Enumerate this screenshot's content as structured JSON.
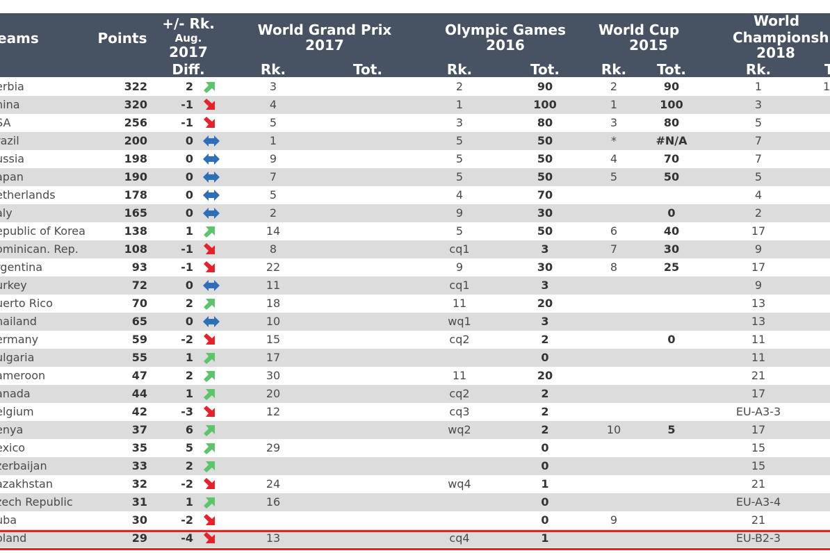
{
  "header": {
    "teams": "eams",
    "points": "Points",
    "rk_change": "+/- Rk.",
    "aug": "Aug.",
    "year_2017": "2017",
    "diff": "Diff.",
    "wgp_line1": "World Grand Prix",
    "wgp_line2": "2017",
    "og_line1": "Olympic Games",
    "og_line2": "2016",
    "wc_line1": "World Cup",
    "wc_line2": "2015",
    "wch_line1": "World",
    "wch_line2": "Championship",
    "wch_line3": "2018",
    "rk": "Rk.",
    "tot": "Tot.",
    "t_cut": "T"
  },
  "colors": {
    "header_bg": "#475362",
    "alt_row": "#dcdcdc",
    "up": "#5cc46b",
    "down": "#e8202a",
    "same": "#2e6fb7",
    "highlight": "#e8202a"
  },
  "rows": [
    {
      "team": "erbia",
      "points": "322",
      "diff": "2",
      "trend": "up",
      "wgp_rk": "3",
      "og_rk": "2",
      "og_tot": "90",
      "wc_rk": "2",
      "wc_tot": "90",
      "wch_rk": "1",
      "wch_tot": "1"
    },
    {
      "team": "hina",
      "points": "320",
      "diff": "-1",
      "trend": "down",
      "wgp_rk": "4",
      "og_rk": "1",
      "og_tot": "100",
      "wc_rk": "1",
      "wc_tot": "100",
      "wch_rk": "3",
      "wch_tot": ""
    },
    {
      "team": "SA",
      "points": "256",
      "diff": "-1",
      "trend": "down",
      "wgp_rk": "5",
      "og_rk": "3",
      "og_tot": "80",
      "wc_rk": "3",
      "wc_tot": "80",
      "wch_rk": "5",
      "wch_tot": ""
    },
    {
      "team": "razil",
      "points": "200",
      "diff": "0",
      "trend": "same",
      "wgp_rk": "1",
      "og_rk": "5",
      "og_tot": "50",
      "wc_rk": "*",
      "wc_tot": "#N/A",
      "wch_rk": "7",
      "wch_tot": ""
    },
    {
      "team": "ussia",
      "points": "198",
      "diff": "0",
      "trend": "same",
      "wgp_rk": "9",
      "og_rk": "5",
      "og_tot": "50",
      "wc_rk": "4",
      "wc_tot": "70",
      "wch_rk": "7",
      "wch_tot": ""
    },
    {
      "team": "apan",
      "points": "190",
      "diff": "0",
      "trend": "same",
      "wgp_rk": "7",
      "og_rk": "5",
      "og_tot": "50",
      "wc_rk": "5",
      "wc_tot": "50",
      "wch_rk": "5",
      "wch_tot": ""
    },
    {
      "team": "etherlands",
      "points": "178",
      "diff": "0",
      "trend": "same",
      "wgp_rk": "5",
      "og_rk": "4",
      "og_tot": "70",
      "wc_rk": "",
      "wc_tot": "",
      "wch_rk": "4",
      "wch_tot": ""
    },
    {
      "team": "aly",
      "points": "165",
      "diff": "0",
      "trend": "same",
      "wgp_rk": "2",
      "og_rk": "9",
      "og_tot": "30",
      "wc_rk": "",
      "wc_tot": "0",
      "wch_rk": "2",
      "wch_tot": ""
    },
    {
      "team": "epublic of Korea",
      "points": "138",
      "diff": "1",
      "trend": "up",
      "wgp_rk": "14",
      "og_rk": "5",
      "og_tot": "50",
      "wc_rk": "6",
      "wc_tot": "40",
      "wch_rk": "17",
      "wch_tot": ""
    },
    {
      "team": "ominican. Rep.",
      "points": "108",
      "diff": "-1",
      "trend": "down",
      "wgp_rk": "8",
      "og_rk": "cq1",
      "og_tot": "3",
      "wc_rk": "7",
      "wc_tot": "30",
      "wch_rk": "9",
      "wch_tot": ""
    },
    {
      "team": "rgentina",
      "points": "93",
      "diff": "-1",
      "trend": "down",
      "wgp_rk": "22",
      "og_rk": "9",
      "og_tot": "30",
      "wc_rk": "8",
      "wc_tot": "25",
      "wch_rk": "17",
      "wch_tot": ""
    },
    {
      "team": "urkey",
      "points": "72",
      "diff": "0",
      "trend": "same",
      "wgp_rk": "11",
      "og_rk": "cq1",
      "og_tot": "3",
      "wc_rk": "",
      "wc_tot": "",
      "wch_rk": "9",
      "wch_tot": ""
    },
    {
      "team": "uerto Rico",
      "points": "70",
      "diff": "2",
      "trend": "up",
      "wgp_rk": "18",
      "og_rk": "11",
      "og_tot": "20",
      "wc_rk": "",
      "wc_tot": "",
      "wch_rk": "13",
      "wch_tot": ""
    },
    {
      "team": "hailand",
      "points": "65",
      "diff": "0",
      "trend": "same",
      "wgp_rk": "10",
      "og_rk": "wq1",
      "og_tot": "3",
      "wc_rk": "",
      "wc_tot": "",
      "wch_rk": "13",
      "wch_tot": ""
    },
    {
      "team": "ermany",
      "points": "59",
      "diff": "-2",
      "trend": "down",
      "wgp_rk": "15",
      "og_rk": "cq2",
      "og_tot": "2",
      "wc_rk": "",
      "wc_tot": "0",
      "wch_rk": "11",
      "wch_tot": ""
    },
    {
      "team": "ulgaria",
      "points": "55",
      "diff": "1",
      "trend": "up",
      "wgp_rk": "17",
      "og_rk": "",
      "og_tot": "0",
      "wc_rk": "",
      "wc_tot": "",
      "wch_rk": "11",
      "wch_tot": ""
    },
    {
      "team": "ameroon",
      "points": "47",
      "diff": "2",
      "trend": "up",
      "wgp_rk": "30",
      "og_rk": "11",
      "og_tot": "20",
      "wc_rk": "",
      "wc_tot": "",
      "wch_rk": "21",
      "wch_tot": ""
    },
    {
      "team": "anada",
      "points": "44",
      "diff": "1",
      "trend": "up",
      "wgp_rk": "20",
      "og_rk": "cq2",
      "og_tot": "2",
      "wc_rk": "",
      "wc_tot": "",
      "wch_rk": "17",
      "wch_tot": ""
    },
    {
      "team": "elgium",
      "points": "42",
      "diff": "-3",
      "trend": "down",
      "wgp_rk": "12",
      "og_rk": "cq3",
      "og_tot": "2",
      "wc_rk": "",
      "wc_tot": "",
      "wch_rk": "EU-A3-3",
      "wch_tot": ""
    },
    {
      "team": "enya",
      "points": "37",
      "diff": "6",
      "trend": "up",
      "wgp_rk": "",
      "og_rk": "wq2",
      "og_tot": "2",
      "wc_rk": "10",
      "wc_tot": "5",
      "wch_rk": "17",
      "wch_tot": ""
    },
    {
      "team": "exico",
      "points": "35",
      "diff": "5",
      "trend": "up",
      "wgp_rk": "29",
      "og_rk": "",
      "og_tot": "0",
      "wc_rk": "",
      "wc_tot": "",
      "wch_rk": "15",
      "wch_tot": ""
    },
    {
      "team": "zerbaijan",
      "points": "33",
      "diff": "2",
      "trend": "up",
      "wgp_rk": "",
      "og_rk": "",
      "og_tot": "0",
      "wc_rk": "",
      "wc_tot": "",
      "wch_rk": "15",
      "wch_tot": ""
    },
    {
      "team": "azakhstan",
      "points": "32",
      "diff": "-2",
      "trend": "down",
      "wgp_rk": "24",
      "og_rk": "wq4",
      "og_tot": "1",
      "wc_rk": "",
      "wc_tot": "",
      "wch_rk": "21",
      "wch_tot": ""
    },
    {
      "team": "zech Republic",
      "points": "31",
      "diff": "1",
      "trend": "up",
      "wgp_rk": "16",
      "og_rk": "",
      "og_tot": "0",
      "wc_rk": "",
      "wc_tot": "",
      "wch_rk": "EU-A3-4",
      "wch_tot": ""
    },
    {
      "team": "uba",
      "points": "30",
      "diff": "-2",
      "trend": "down",
      "wgp_rk": "",
      "og_rk": "",
      "og_tot": "0",
      "wc_rk": "9",
      "wc_tot": "",
      "wch_rk": "21",
      "wch_tot": ""
    },
    {
      "team": "oland",
      "points": "29",
      "diff": "-4",
      "trend": "down",
      "wgp_rk": "13",
      "og_rk": "cq4",
      "og_tot": "1",
      "wc_rk": "",
      "wc_tot": "",
      "wch_rk": "EU-B2-3",
      "wch_tot": ""
    }
  ]
}
